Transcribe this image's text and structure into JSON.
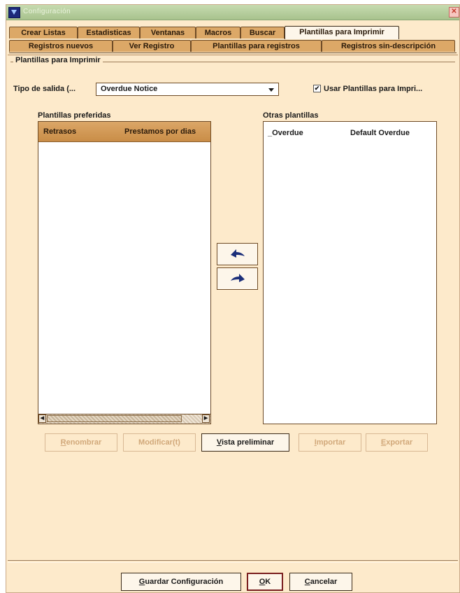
{
  "window": {
    "title": "Configuración",
    "close_glyph": "✕"
  },
  "tabs_row1": [
    {
      "label": "Crear Listas",
      "active": false
    },
    {
      "label": "Estadisticas",
      "active": false
    },
    {
      "label": "Ventanas",
      "active": false
    },
    {
      "label": "Macros",
      "active": false
    },
    {
      "label": "Buscar",
      "active": false
    },
    {
      "label": "Plantillas para Imprimir",
      "active": true
    }
  ],
  "tabs_row2": [
    {
      "label": "Registros nuevos"
    },
    {
      "label": "Ver Registro"
    },
    {
      "label": "Plantillas para registros"
    },
    {
      "label": "Registros sin-descripción"
    }
  ],
  "section": {
    "title": "Plantillas para Imprimir"
  },
  "output_type": {
    "label": "Tipo de salida (...",
    "value": "Overdue Notice"
  },
  "use_templates": {
    "label": "Usar Plantillas para Impri...",
    "checked": true,
    "check_glyph": "✔"
  },
  "preferred": {
    "label": "Plantillas preferidas",
    "columns": [
      "Retrasos",
      "Prestamos por dias"
    ],
    "rows": []
  },
  "others": {
    "label": "Otras plantillas",
    "rows": [
      {
        "name": "_Overdue",
        "desc": "Default Overdue"
      }
    ]
  },
  "scroll": {
    "left_glyph": "◀",
    "right_glyph": "▶"
  },
  "actions": {
    "rename": "Renombrar",
    "modify": "Modificar(t)",
    "preview": "Vista preliminar",
    "import": "Importar",
    "export": "Exportar"
  },
  "footer": {
    "save": "Guardar Configuración",
    "ok": "OK",
    "cancel": "Cancelar"
  },
  "colors": {
    "background": "#fdeacb",
    "tab": "#dca867",
    "arrow": "#1c2f7a"
  },
  "icons": {
    "move_left": "arrow-left-icon",
    "move_right": "arrow-right-icon"
  }
}
